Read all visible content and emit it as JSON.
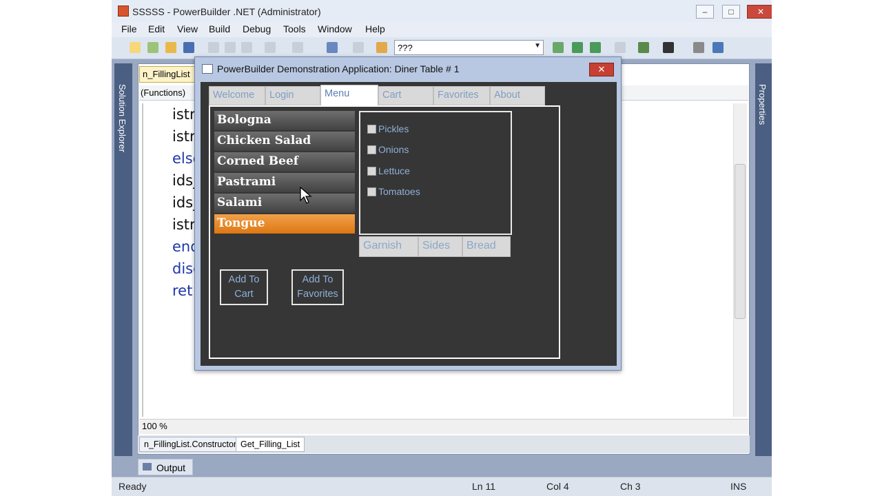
{
  "ide": {
    "title": "SSSSS - PowerBuilder .NET (Administrator)",
    "menu": [
      "File",
      "Edit",
      "View",
      "Build",
      "Debug",
      "Tools",
      "Window",
      "Help"
    ],
    "combo_value": "???",
    "solution_explorer": "Solution Explorer",
    "properties": "Properties",
    "doc_tab": "n_FillingList",
    "functions_label": "(Functions)",
    "code_lines": [
      "istr",
      "istr",
      "else",
      "ids_",
      "ids_",
      "istr",
      "end",
      "disc",
      "ret"
    ],
    "zoom": "100 %",
    "bottom_tabs": [
      "n_FillingList.Constructor",
      "Get_Filling_List"
    ],
    "output": "Output",
    "status": {
      "ready": "Ready",
      "ln": "Ln 11",
      "col": "Col 4",
      "ch": "Ch 3",
      "ins": "INS"
    }
  },
  "dialog": {
    "title": "PowerBuilder Demonstration Application: Diner Table # 1",
    "tabs": [
      "Welcome",
      "Login",
      "Menu",
      "Cart",
      "Favorites",
      "About"
    ],
    "active_tab": "Menu",
    "items": [
      "Bologna",
      "Chicken Salad",
      "Corned Beef",
      "Pastrami",
      "Salami",
      "Tongue"
    ],
    "selected_item": "Tongue",
    "options": [
      "Pickles",
      "Onions",
      "Lettuce",
      "Tomatoes"
    ],
    "panel_tabs": [
      "Garnish",
      "Sides",
      "Bread"
    ],
    "buttons": {
      "add_cart": "Add To Cart",
      "add_fav": "Add To Favorites"
    }
  },
  "colors": {
    "accent_selected": "#e58220",
    "ide_frame": "#9aa8c2"
  }
}
